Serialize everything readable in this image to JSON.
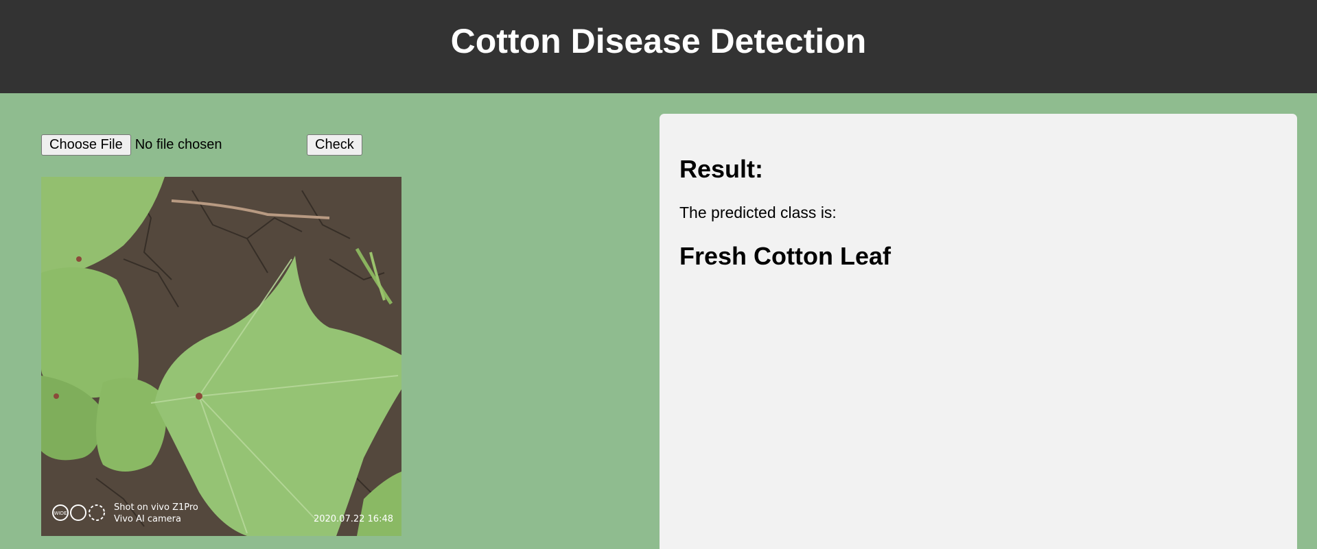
{
  "header": {
    "title": "Cotton Disease Detection"
  },
  "upload": {
    "choose_file_label": "Choose File",
    "file_status": "No file chosen",
    "check_label": "Check"
  },
  "preview": {
    "watermark_line1": "Shot on vivo Z1Pro",
    "watermark_line2": "Vivo AI camera",
    "watermark_timestamp": "2020.07.22 16:48",
    "wide_badge": "WIDE"
  },
  "result": {
    "heading": "Result:",
    "text": "The predicted class is:",
    "predicted_class": "Fresh Cotton Leaf"
  },
  "colors": {
    "header_bg": "#333333",
    "page_bg": "#8fbc8f",
    "panel_bg": "#f2f2f2"
  }
}
